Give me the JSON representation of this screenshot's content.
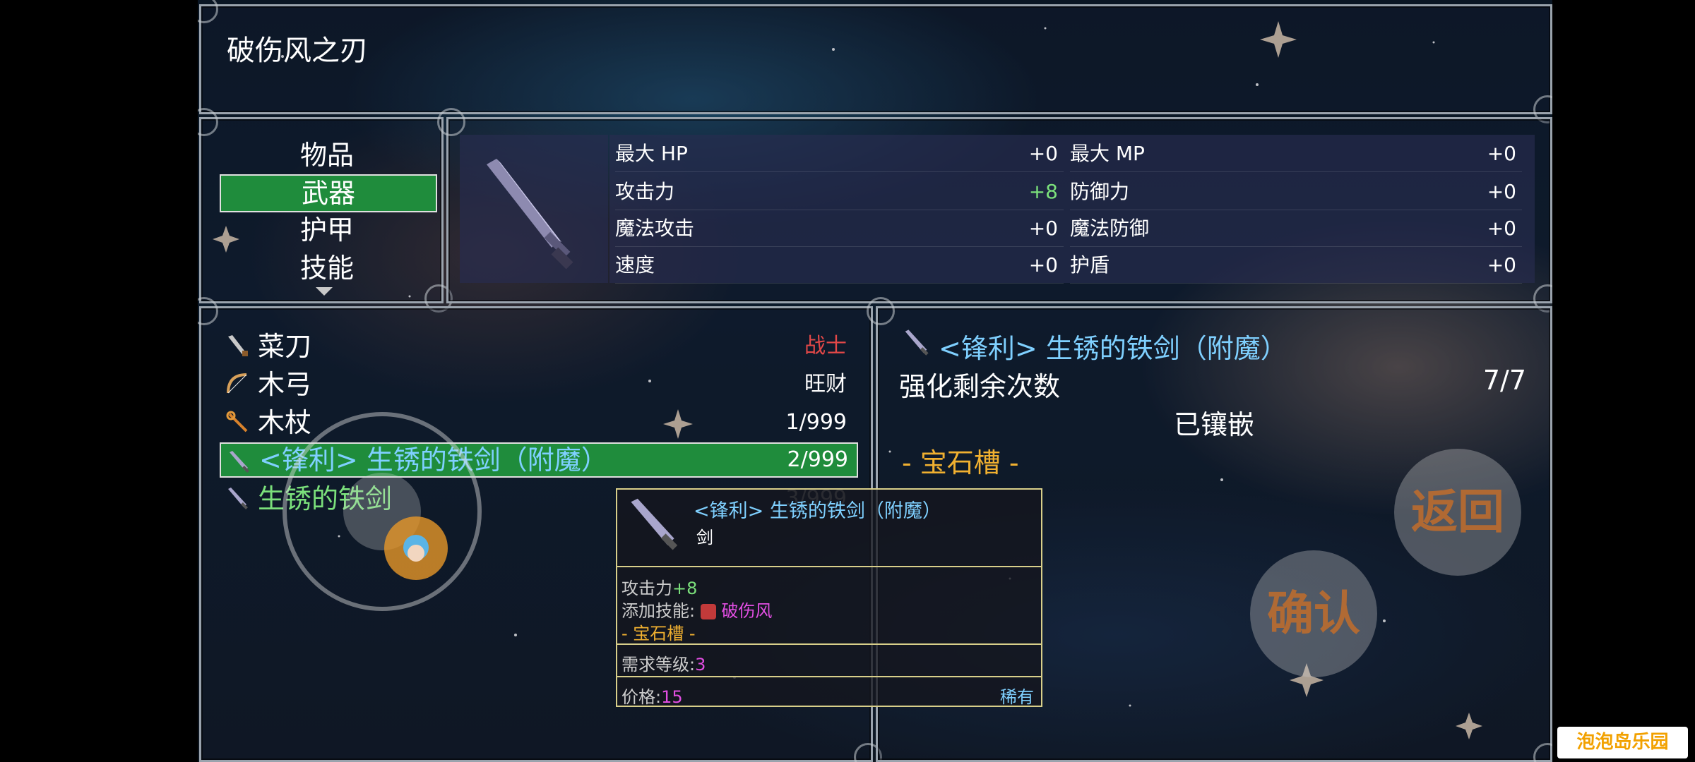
{
  "header": {
    "title": "破伤风之刃"
  },
  "categories": {
    "items": [
      "物品",
      "武器",
      "护甲",
      "技能"
    ]
  },
  "stats": {
    "max_hp": {
      "label": "最大 HP",
      "value": "+0"
    },
    "max_mp": {
      "label": "最大 MP",
      "value": "+0"
    },
    "atk": {
      "label": "攻击力",
      "value": "+8"
    },
    "def": {
      "label": "防御力",
      "value": "+0"
    },
    "matk": {
      "label": "魔法攻击",
      "value": "+0"
    },
    "mdef": {
      "label": "魔法防御",
      "value": "+0"
    },
    "spd": {
      "label": "速度",
      "value": "+0"
    },
    "shield": {
      "label": "护盾",
      "value": "+0"
    },
    "colors": {
      "positive": "#7be07b",
      "normal": "#dcdcdc"
    }
  },
  "items": [
    {
      "name": "菜刀",
      "count": "战士",
      "icon": "knife-icon"
    },
    {
      "name": "木弓",
      "count": "旺财",
      "icon": "bow-icon"
    },
    {
      "name": "木杖",
      "count": "1/999",
      "icon": "staff-icon"
    },
    {
      "name": "<锋利> 生锈的铁剑（附魔）",
      "count": "2/999",
      "icon": "sword-icon"
    },
    {
      "name": "生锈的铁剑",
      "count": "3/999",
      "icon": "sword-icon"
    }
  ],
  "detail": {
    "title": "<锋利> 生锈的铁剑（附魔）",
    "enhance_label": "强化剩余次数",
    "enhance_value": "7/7",
    "inlaid_label": "已镶嵌",
    "gem_slot": "- 宝石槽 -"
  },
  "tooltip": {
    "name": "<锋利> 生锈的铁剑（附魔）",
    "type": "剑",
    "atk_label": "攻击力",
    "atk_value": "+8",
    "skill_label": "添加技能:",
    "skill_value": "破伤风",
    "gem_slot": "- 宝石槽 -",
    "req_label": "需求等级:",
    "req_value": "3",
    "price_label": "价格:",
    "price_value": "15",
    "rarity": "稀有"
  },
  "buttons": {
    "back": "返回",
    "confirm": "确认"
  },
  "watermark": "泡泡岛乐园"
}
